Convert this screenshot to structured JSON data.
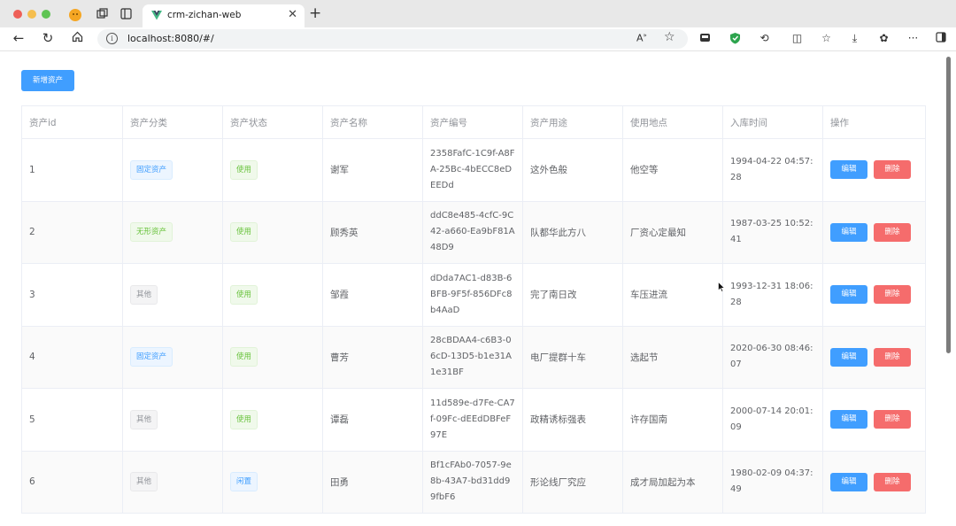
{
  "browser": {
    "tab_title": "crm-zichan-web",
    "url": "localhost:8080/#/",
    "icons": [
      "workspaces-icon",
      "tab-actions-icon",
      "refresh-icon",
      "home-icon",
      "read-aloud-icon",
      "favorite-icon",
      "extensions-icon",
      "collections-icon",
      "downloads-icon",
      "more-icon"
    ]
  },
  "page": {
    "add_button_label": "新增资产",
    "columns": [
      "资产id",
      "资产分类",
      "资产状态",
      "资产名称",
      "资产编号",
      "资产用途",
      "使用地点",
      "入库时间",
      "操作"
    ],
    "edit_label": "编辑",
    "delete_label": "删除",
    "rows": [
      {
        "id": "1",
        "category": "固定资产",
        "category_type": "primary",
        "status": "使用",
        "status_type": "success",
        "name": "谢军",
        "code": "2358FafC-1C9f-A8FA-25Bc-4bECC8eDEEDd",
        "purpose": "这外色般",
        "location": "他空等",
        "date": "1994-04-22 04:57:28"
      },
      {
        "id": "2",
        "category": "无形资产",
        "category_type": "success",
        "status": "使用",
        "status_type": "success",
        "name": "顾秀英",
        "code": "ddC8e485-4cfC-9C42-a660-Ea9bF81A48D9",
        "purpose": "队都华此方八",
        "location": "厂资心定最知",
        "date": "1987-03-25 10:52:41"
      },
      {
        "id": "3",
        "category": "其他",
        "category_type": "info",
        "status": "使用",
        "status_type": "success",
        "name": "邹霞",
        "code": "dDda7AC1-d83B-6BFB-9F5f-856DFc8b4AaD",
        "purpose": "完了南日改",
        "location": "车压进流",
        "date": "1993-12-31 18:06:28"
      },
      {
        "id": "4",
        "category": "固定资产",
        "category_type": "primary",
        "status": "使用",
        "status_type": "success",
        "name": "曹芳",
        "code": "28cBDAA4-c6B3-06cD-13D5-b1e31A1e31BF",
        "purpose": "电厂提群十车",
        "location": "选起节",
        "date": "2020-06-30 08:46:07"
      },
      {
        "id": "5",
        "category": "其他",
        "category_type": "info",
        "status": "使用",
        "status_type": "success",
        "name": "谭磊",
        "code": "11d589e-d7Fe-CA7f-09Fc-dEEdDBFeF97E",
        "purpose": "政精诱标强表",
        "location": "许存国南",
        "date": "2000-07-14 20:01:09"
      },
      {
        "id": "6",
        "category": "其他",
        "category_type": "info",
        "status": "闲置",
        "status_type": "primary",
        "name": "田勇",
        "code": "Bf1cFAb0-7057-9e8b-43A7-bd31dd99fbF6",
        "purpose": "形论线厂究应",
        "location": "成才局加起为本",
        "date": "1980-02-09 04:37:49"
      }
    ]
  },
  "colors": {
    "primary": "#409eff",
    "danger": "#f56c6c",
    "success": "#67c23a",
    "info": "#909399"
  }
}
